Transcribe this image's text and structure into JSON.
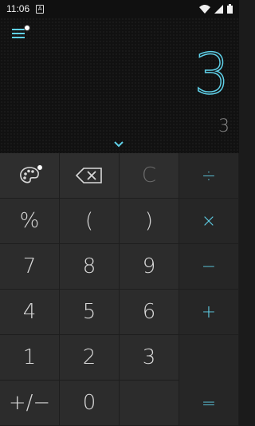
{
  "status_bar": {
    "time": "11:06",
    "notification_icon": "A",
    "icons": [
      "wifi-icon",
      "signal-icon",
      "battery-icon"
    ]
  },
  "display": {
    "result": "3",
    "expression": "3",
    "accent_color": "#5fd0e8"
  },
  "keypad": {
    "row0": {
      "theme": "palette-icon",
      "backspace": "backspace-icon",
      "clear": "C",
      "divide": "÷"
    },
    "row1": {
      "percent": "%",
      "open_paren": "(",
      "close_paren": ")",
      "multiply": "×"
    },
    "row2": {
      "seven": "7",
      "eight": "8",
      "nine": "9",
      "minus": "−"
    },
    "row3": {
      "four": "4",
      "five": "5",
      "six": "6",
      "plus": "+"
    },
    "row4": {
      "one": "1",
      "two": "2",
      "three": "3"
    },
    "row5": {
      "sign": "+/−",
      "zero": "0",
      "equals": "="
    }
  }
}
